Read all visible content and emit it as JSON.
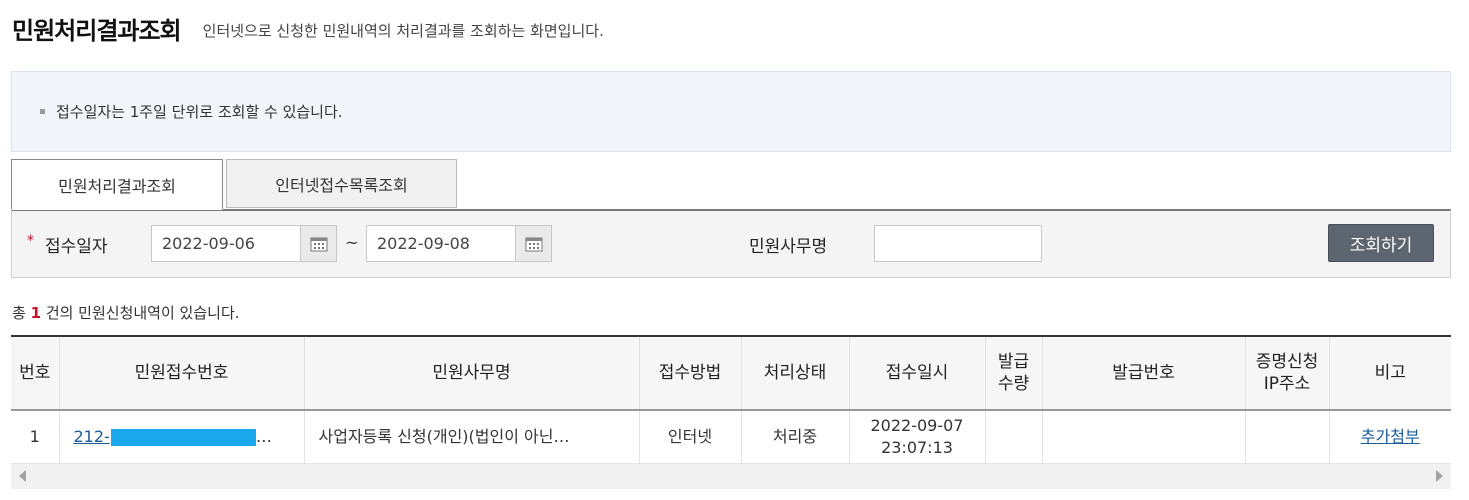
{
  "header": {
    "title": "민원처리결과조회",
    "description": "인터넷으로 신청한 민원내역의 처리결과를 조회하는 화면입니다."
  },
  "notice": {
    "text": "접수일자는 1주일 단위로 조회할 수 있습니다."
  },
  "tabs": [
    {
      "label": "민원처리결과조회",
      "active": true
    },
    {
      "label": "인터넷접수목록조회",
      "active": false
    }
  ],
  "search": {
    "date_label": "접수일자",
    "required_mark": "*",
    "date_from": "2022-09-06",
    "date_to": "2022-09-08",
    "range_separator": "~",
    "office_label": "민원사무명",
    "office_value": "",
    "button_label": "조회하기"
  },
  "summary": {
    "prefix": "총",
    "count": "1",
    "suffix": "건의 민원신청내역이 있습니다."
  },
  "table": {
    "headers": {
      "no": "번호",
      "receipt_no": "민원접수번호",
      "office_name": "민원사무명",
      "method": "접수방법",
      "status": "처리상태",
      "received_at": "접수일시",
      "issue_qty_1": "발급",
      "issue_qty_2": "수량",
      "issue_no": "발급번호",
      "ip_1": "증명신청",
      "ip_2": "IP주소",
      "remark": "비고"
    },
    "rows": [
      {
        "no": "1",
        "receipt_no_prefix": "212-",
        "receipt_no_suffix": "…",
        "office_name": "사업자등록 신청(개인)(법인이 아닌…",
        "method": "인터넷",
        "status": "처리중",
        "received_date": "2022-09-07",
        "received_time": "23:07:13",
        "issue_qty": "",
        "issue_no": "",
        "ip": "",
        "remark": "추가첨부"
      }
    ]
  },
  "colors": {
    "accent_red": "#c8102e",
    "link_blue": "#1a5c9a",
    "mask_blue": "#1aa7ec",
    "button_gray": "#5d6570"
  }
}
